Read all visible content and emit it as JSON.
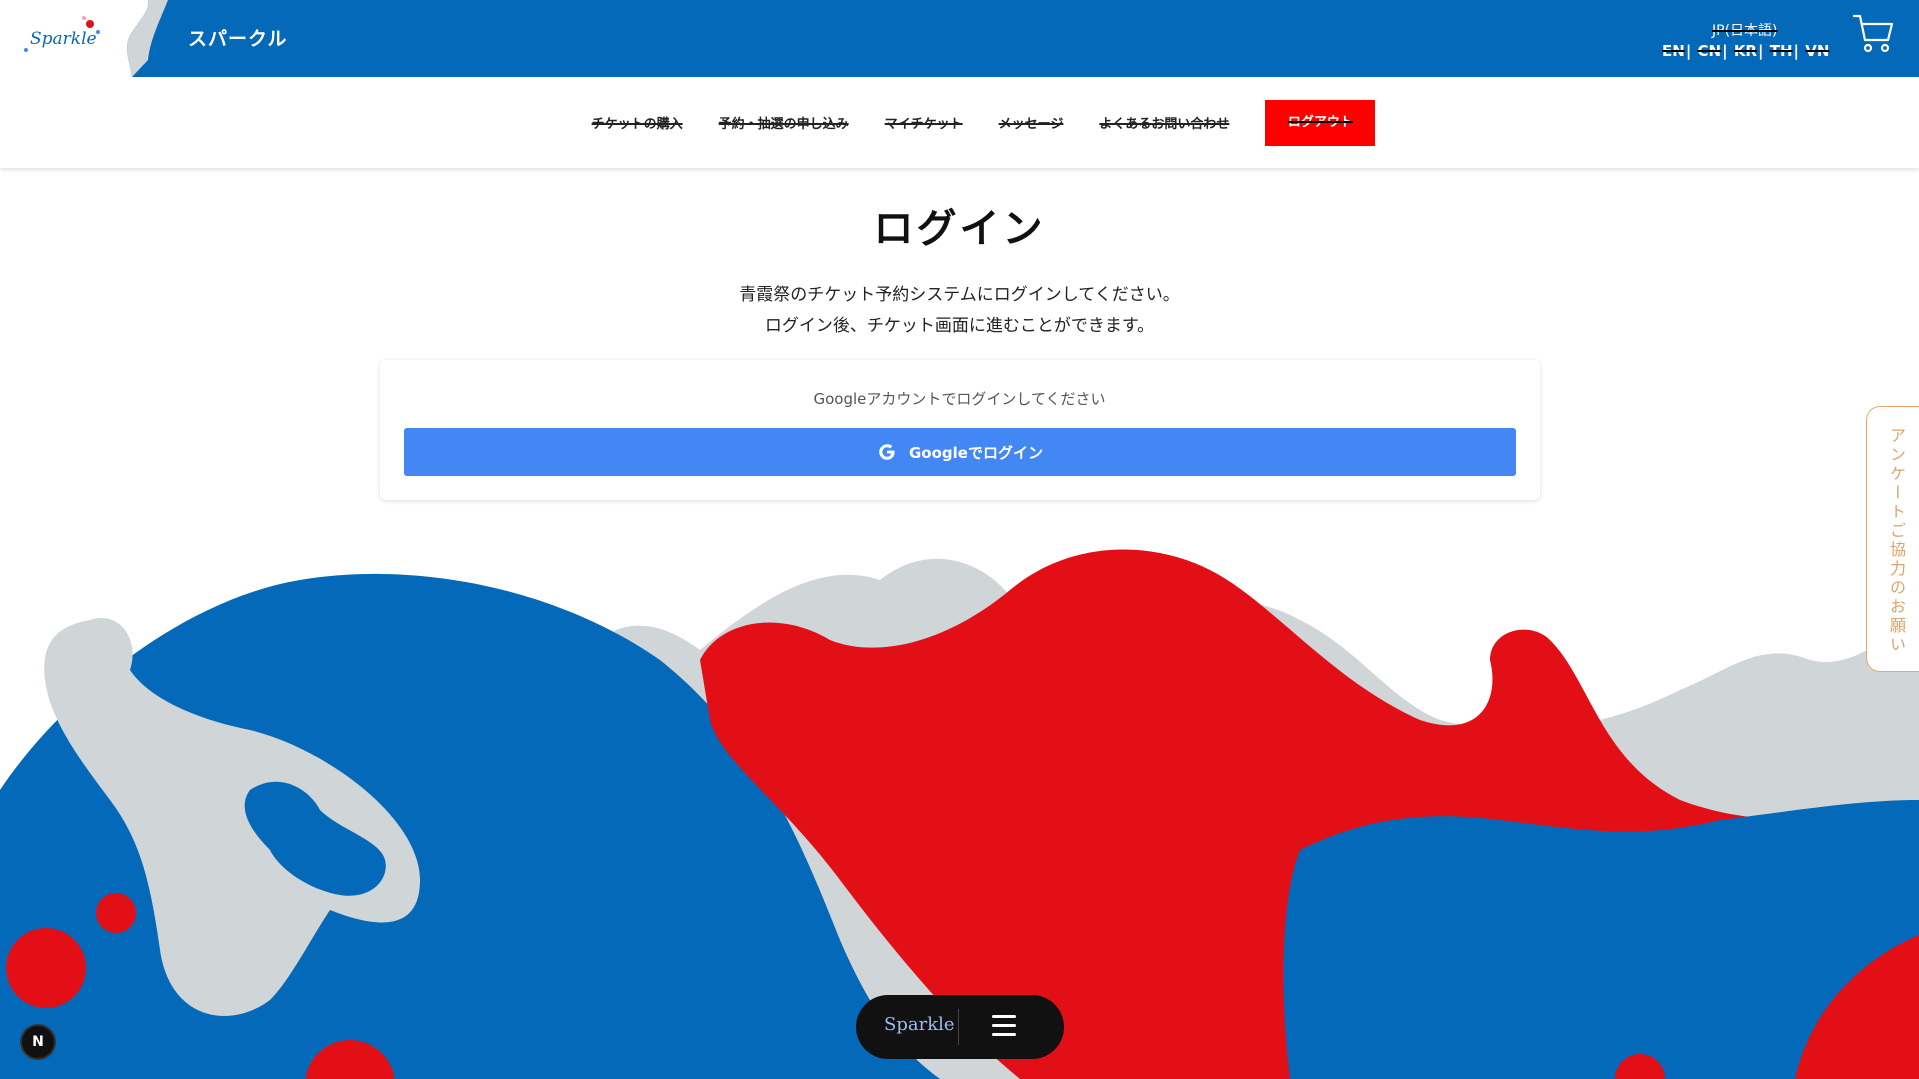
{
  "header": {
    "logo_text": "Sparkle",
    "site_title": "スパークル",
    "language_current": "JP(日本語)",
    "languages": [
      "EN",
      "CN",
      "KR",
      "TH",
      "VN"
    ],
    "cart_icon": "cart-icon"
  },
  "nav": {
    "items": [
      "チケットの購入",
      "予約・抽選の申し込み",
      "マイチケット",
      "メッセージ",
      "よくあるお問い合わせ"
    ],
    "logout_label": "ログアウト"
  },
  "main": {
    "title": "ログイン",
    "description_line1": "青霞祭のチケット予約システムにログインしてください。",
    "description_line2": "ログイン後、チケット画面に進むことができます。",
    "card_text": "Googleアカウントでログインしてください",
    "google_button_label": "Googleでログイン"
  },
  "survey": {
    "label": "アンケートご協力のお願い"
  },
  "bottom_menu": {
    "label": "Sparkle",
    "menu_icon": "hamburger-icon"
  },
  "badge": {
    "label": "N"
  },
  "colors": {
    "header_blue": "#0369b8",
    "accent_red": "#e30f17",
    "logout_red": "#ff0000",
    "google_blue": "#4387f5",
    "shape_gray": "#d0d5d8"
  }
}
